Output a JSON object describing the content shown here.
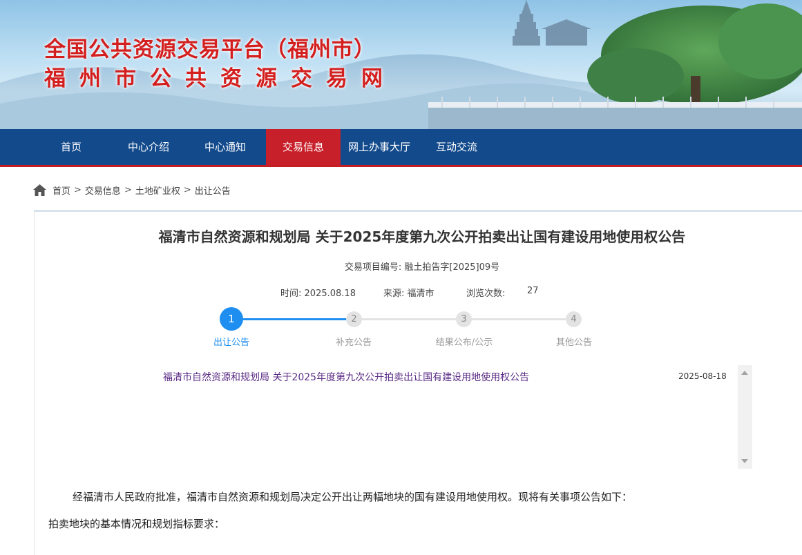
{
  "header": {
    "title_line1": "全国公共资源交易平台（福州市）",
    "title_line2": "福州市公共资源交易网"
  },
  "nav": {
    "items": [
      {
        "label": "首页"
      },
      {
        "label": "中心介绍"
      },
      {
        "label": "中心通知"
      },
      {
        "label": "交易信息"
      },
      {
        "label": "网上办事大厅"
      },
      {
        "label": "互动交流"
      }
    ],
    "active": "交易信息"
  },
  "breadcrumb": [
    "首页",
    "交易信息",
    "土地矿业权",
    "出让公告"
  ],
  "breadcrumb_separator": ">",
  "article": {
    "title": "福清市自然资源和规划局 关于2025年度第九次公开拍卖出让国有建设用地使用权公告",
    "project_no_label": "交易项目编号:",
    "project_no": "融土拍告字[2025]09号",
    "time_label": "时间:",
    "time": "2025.08.18",
    "source_label": "来源:",
    "source": "福清市",
    "views_label": "浏览次数:",
    "views": "27"
  },
  "steps": [
    {
      "num": "1",
      "label": "出让公告",
      "active": true
    },
    {
      "num": "2",
      "label": "补充公告",
      "active": false
    },
    {
      "num": "3",
      "label": "结果公布/公示",
      "active": false
    },
    {
      "num": "4",
      "label": "其他公告",
      "active": false
    }
  ],
  "list": [
    {
      "title": "福清市自然资源和规划局 关于2025年度第九次公开拍卖出让国有建设用地使用权公告",
      "date": "2025-08-18"
    }
  ],
  "body": {
    "para1": "经福清市人民政府批准，福清市自然资源和规划局决定公开出让两幅地块的国有建设用地使用权。现将有关事项公告如下：",
    "para2": "拍卖地块的基本情况和规划指标要求："
  },
  "colors": {
    "nav_bg": "#124a8c",
    "nav_active": "#c8202a",
    "title_red": "#d41f1f",
    "step_active": "#1e8ff0",
    "link_purple": "#5b2c86"
  }
}
